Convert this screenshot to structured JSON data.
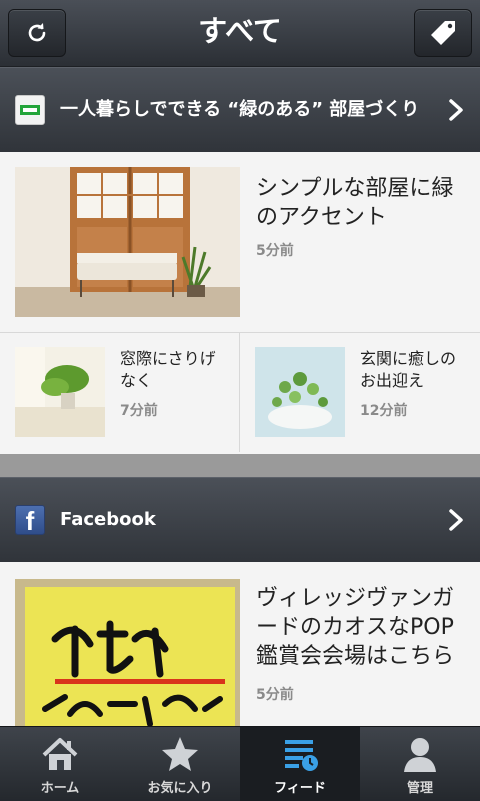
{
  "header": {
    "title": "すべて"
  },
  "sections": [
    {
      "label": "一人暮らしでできる “緑のある” 部屋づくり",
      "feature": {
        "title": "シンプルな部屋に緑のアクセント",
        "time": "5分前"
      },
      "items": [
        {
          "title": "窓際にさりげなく",
          "time": "7分前"
        },
        {
          "title": "玄関に癒しのお出迎え",
          "time": "12分前"
        }
      ]
    },
    {
      "label": "Facebook",
      "feature": {
        "title": "ヴィレッジヴァンガードのカオスなPOP鑑賞会会場はこちら",
        "time": "5分前"
      }
    }
  ],
  "bottom_nav": [
    {
      "label": "ホーム",
      "icon": "home-icon"
    },
    {
      "label": "お気に入り",
      "icon": "star-icon"
    },
    {
      "label": "フィード",
      "icon": "feed-icon",
      "active": true
    },
    {
      "label": "管理",
      "icon": "user-icon"
    }
  ],
  "colors": {
    "bar": "#2b2f35",
    "feed_accent": "#3aa0e6",
    "green_icon": "#24a53b"
  }
}
